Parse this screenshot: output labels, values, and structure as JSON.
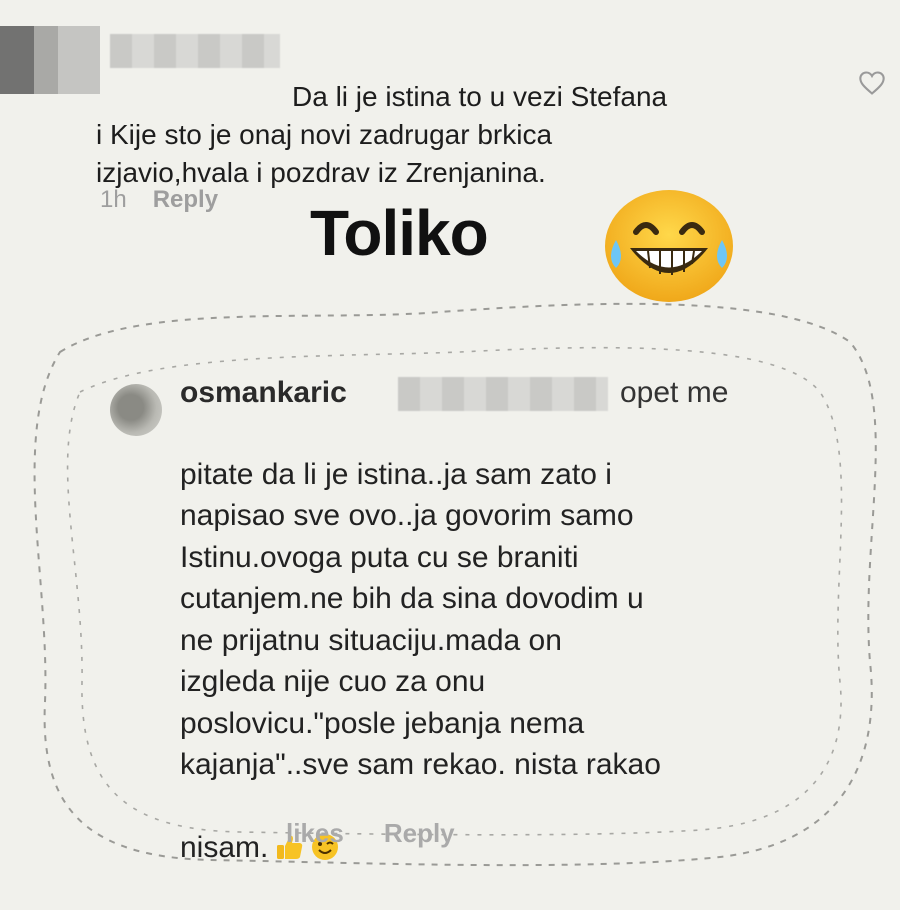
{
  "top_comment": {
    "text": "Da li je istina to u vezi Stefana\ni Kije sto je onaj novi zadrugar brkica\nizjavio,hvala i pozdrav iz Zrenjanina.",
    "time": "1h",
    "reply_label": "Reply",
    "icon": "heart-icon"
  },
  "caption": {
    "text": "Toliko",
    "emoji": "laughing-tears-emoji"
  },
  "reply_comment": {
    "username": "osmankaric",
    "lead": "opet me",
    "text": "pitate da li je istina..ja sam zato i\nnapisao sve ovo..ja govorim samo\nIstinu.ovoga puta cu se braniti\ncutanjem.ne bih da sina dovodim u\nne prijatnu situaciju.mada on\nizgleda nije cuo za onu\nposlovicu.\"posle jebanja nema\nkajanja\"..sve sam rekao. nista rakao",
    "last_line": "nisam.",
    "emojis": [
      "thumbs-up-emoji",
      "wink-emoji"
    ],
    "likes_label": "likes",
    "reply_label": "Reply"
  },
  "colors": {
    "background": "#f1f1ec",
    "text": "#1d1d1d",
    "meta": "#9e9e9e",
    "emoji_yellow": "#f7c324"
  }
}
